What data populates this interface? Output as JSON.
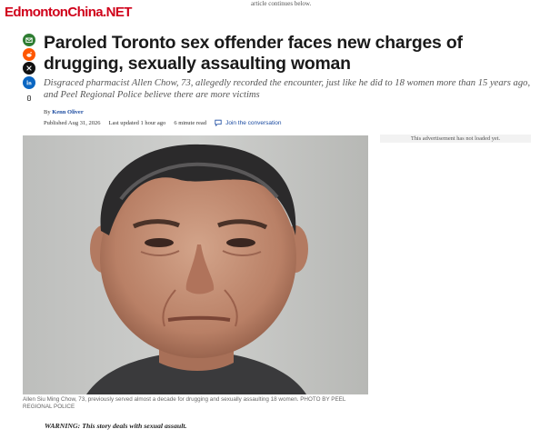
{
  "site": {
    "logo_text": "EdmontonChina.NET",
    "logo_color": "#d0021b"
  },
  "top_notice": "article continues below.",
  "share_icons": [
    {
      "name": "email-icon",
      "color": "#2e7d32"
    },
    {
      "name": "reddit-icon",
      "color": "#ff5700"
    },
    {
      "name": "x-icon",
      "color": "#111111"
    },
    {
      "name": "linkedin-icon",
      "color": "#0a66c2"
    },
    {
      "name": "copy-link-icon",
      "color": "#ffffff"
    }
  ],
  "article": {
    "headline": "Paroled Toronto sex offender faces new charges of drugging, sexually assaulting woman",
    "dek": "Disgraced pharmacist Allen Chow, 73, allegedly recorded the encounter, just like he did to 18 women more than 15 years ago, and Peel Regional Police believe there are more victims",
    "byline_prefix": "By",
    "author": "Kenn Oliver",
    "published": "Published Aug 31, 2026",
    "updated": "Last updated 1 hour ago",
    "read_time": "6 minute read",
    "join_conversation": "Join the conversation",
    "photo_caption": "Allen Siu Ming Chow, 73, previously served almost a decade for drugging and sexually assaulting 18 women. PHOTO BY PEEL REGIONAL POLICE",
    "warning": "WARNING: This story deals with sexual assault."
  },
  "sidebar": {
    "ad_placeholder": "This advertisement has not loaded yet."
  }
}
